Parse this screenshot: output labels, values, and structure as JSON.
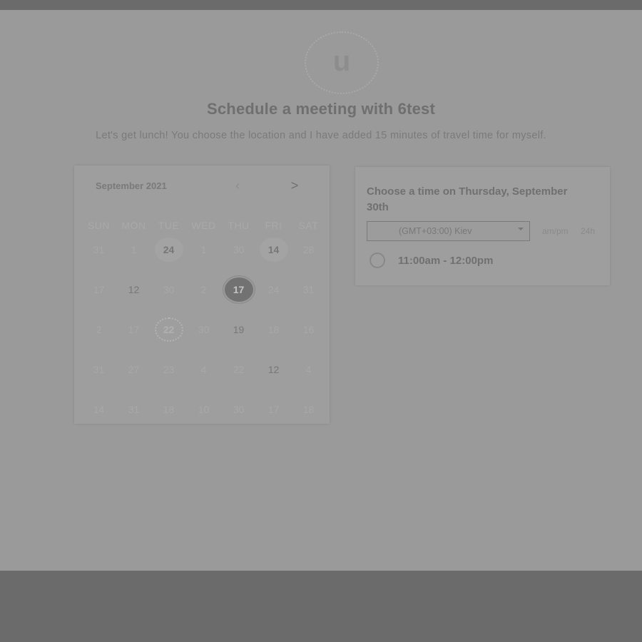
{
  "avatar": {
    "letter": "u"
  },
  "header": {
    "title": "Schedule a meeting with 6test",
    "description": "Let's get lunch! You choose the location and I have added 15 minutes of travel time for myself."
  },
  "calendar": {
    "month_label": "September 2021",
    "prev_icon": "‹",
    "next_icon": ">",
    "weekdays": [
      "SUN",
      "MON",
      "TUE",
      "WED",
      "THU",
      "FRI",
      "SAT"
    ],
    "weeks": [
      [
        {
          "label": "31",
          "state": "disabled"
        },
        {
          "label": "1",
          "state": "disabled"
        },
        {
          "label": "24",
          "state": "highlight"
        },
        {
          "label": "1",
          "state": "disabled"
        },
        {
          "label": "30",
          "state": "disabled"
        },
        {
          "label": "14",
          "state": "highlight"
        },
        {
          "label": "28",
          "state": "disabled"
        }
      ],
      [
        {
          "label": "17",
          "state": "disabled"
        },
        {
          "label": "12",
          "state": "available"
        },
        {
          "label": "30",
          "state": "disabled"
        },
        {
          "label": "2",
          "state": "disabled"
        },
        {
          "label": "17",
          "state": "selected"
        },
        {
          "label": "24",
          "state": "disabled"
        },
        {
          "label": "31",
          "state": "disabled"
        }
      ],
      [
        {
          "label": "2",
          "state": "disabled"
        },
        {
          "label": "17",
          "state": "disabled"
        },
        {
          "label": "22",
          "state": "today"
        },
        {
          "label": "30",
          "state": "disabled"
        },
        {
          "label": "19",
          "state": "available"
        },
        {
          "label": "18",
          "state": "disabled"
        },
        {
          "label": "16",
          "state": "disabled"
        }
      ],
      [
        {
          "label": "31",
          "state": "disabled"
        },
        {
          "label": "27",
          "state": "disabled"
        },
        {
          "label": "23",
          "state": "disabled"
        },
        {
          "label": "4",
          "state": "disabled"
        },
        {
          "label": "22",
          "state": "disabled"
        },
        {
          "label": "12",
          "state": "available"
        },
        {
          "label": "4",
          "state": "disabled"
        }
      ],
      [
        {
          "label": "14",
          "state": "disabled"
        },
        {
          "label": "31",
          "state": "disabled"
        },
        {
          "label": "18",
          "state": "disabled"
        },
        {
          "label": "10",
          "state": "disabled"
        },
        {
          "label": "30",
          "state": "disabled"
        },
        {
          "label": "17",
          "state": "disabled"
        },
        {
          "label": "18",
          "state": "disabled"
        }
      ]
    ]
  },
  "times": {
    "heading": "Choose a time on Thursday, September 30th",
    "timezone": "(GMT+03:00) Kiev",
    "format_ampm": "am/pm",
    "format_24h": "24h",
    "slots": [
      {
        "label": "11:00am - 12:00pm"
      }
    ]
  },
  "colors": {
    "backdrop": "#6b6b6b",
    "page": "#9a9a9a",
    "selected_day": "#727272"
  }
}
